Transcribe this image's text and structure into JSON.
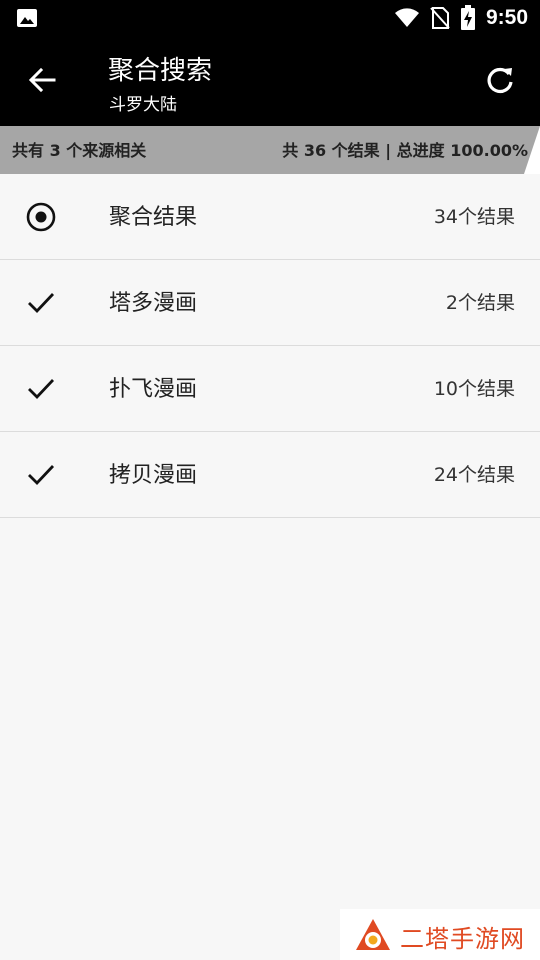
{
  "status_bar": {
    "time": "9:50",
    "icons": [
      "image-icon",
      "wifi-icon",
      "no-sim-icon",
      "battery-charging-icon"
    ]
  },
  "app_bar": {
    "title": "聚合搜索",
    "subtitle": "斗罗大陆",
    "back_icon": "arrow-back-icon",
    "refresh_icon": "refresh-icon"
  },
  "progress": {
    "left_text": "共有 3 个来源相关",
    "right_text": "共 36 个结果 | 总进度 100.00%",
    "percent": 100,
    "fill_color": "#a6a6a6"
  },
  "sources": [
    {
      "name": "聚合结果",
      "count": "34个结果",
      "icon": "radio-selected-icon"
    },
    {
      "name": "塔多漫画",
      "count": "2个结果",
      "icon": "check-icon"
    },
    {
      "name": "扑飞漫画",
      "count": "10个结果",
      "icon": "check-icon"
    },
    {
      "name": "拷贝漫画",
      "count": "24个结果",
      "icon": "check-icon"
    }
  ],
  "watermark": {
    "text": "二塔手游网",
    "color": "#e04a22"
  }
}
